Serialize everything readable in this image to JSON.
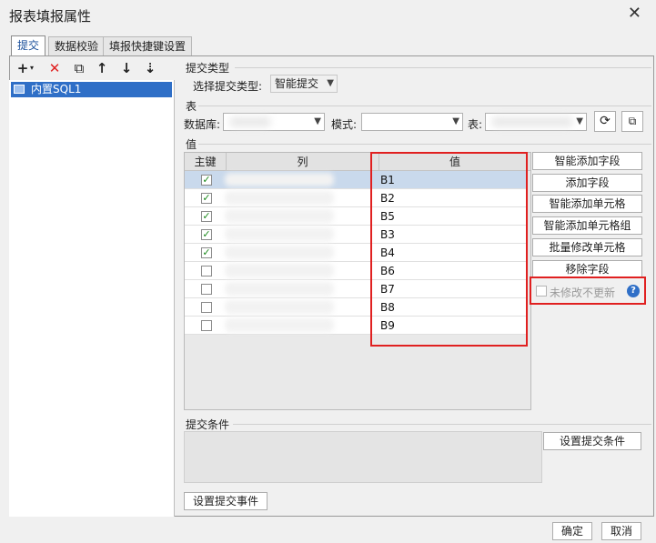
{
  "window": {
    "title": "报表填报属性",
    "close_glyph": "✕"
  },
  "tabs": [
    {
      "label": "提交",
      "active": true
    },
    {
      "label": "数据校验",
      "active": false
    },
    {
      "label": "填报快捷键设置",
      "active": false
    }
  ],
  "toolbar": {
    "add": "+",
    "add_caret": "▾",
    "delete": "✕",
    "copy": "⧉",
    "up": "↑",
    "down": "↓",
    "sort": "⇣"
  },
  "tree": {
    "items": [
      "内置SQL1"
    ]
  },
  "submit_type": {
    "section": "提交类型",
    "label": "选择提交类型:",
    "value": "智能提交"
  },
  "table_section": {
    "section": "表",
    "database_label": "数据库:",
    "schema_label": "模式:",
    "table_label": "表:"
  },
  "values_section": {
    "section": "值",
    "headers": {
      "pk": "主键",
      "column": "列",
      "value": "值"
    },
    "rows": [
      {
        "checked": true,
        "value": "B1"
      },
      {
        "checked": true,
        "value": "B2"
      },
      {
        "checked": true,
        "value": "B5"
      },
      {
        "checked": true,
        "value": "B3"
      },
      {
        "checked": true,
        "value": "B4"
      },
      {
        "checked": false,
        "value": "B6"
      },
      {
        "checked": false,
        "value": "B7"
      },
      {
        "checked": false,
        "value": "B8"
      },
      {
        "checked": false,
        "value": "B9"
      }
    ]
  },
  "side_buttons": {
    "smart_add_field": "智能添加字段",
    "add_field": "添加字段",
    "smart_add_cell": "智能添加单元格",
    "smart_add_cell_group": "智能添加单元格组",
    "batch_modify_cell": "批量修改单元格",
    "remove_field": "移除字段",
    "no_update_unmodified": "未修改不更新"
  },
  "submit_condition": {
    "section": "提交条件",
    "button": "设置提交条件"
  },
  "submit_event_button": "设置提交事件",
  "footer": {
    "ok": "确定",
    "cancel": "取消"
  },
  "colors": {
    "accent": "#2f6fc7",
    "highlight": "#e02020",
    "check": "#1c8a1c"
  }
}
